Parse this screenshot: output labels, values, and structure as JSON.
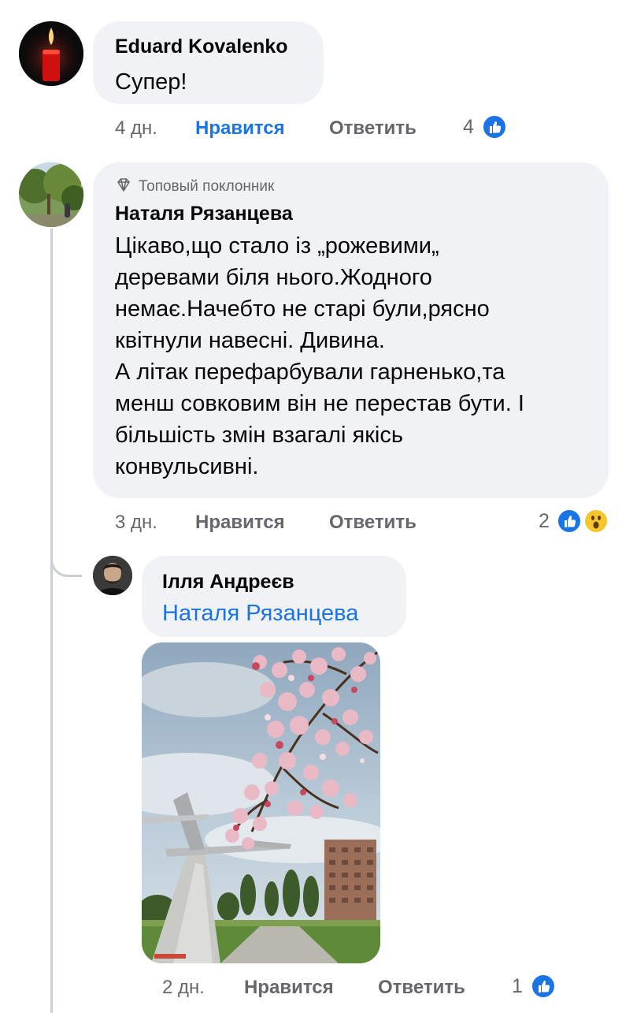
{
  "comments": [
    {
      "author": "Eduard Kovalenko",
      "text": "Супер!",
      "time": "4 дн.",
      "like_label": "Нравится",
      "reply_label": "Ответить",
      "reaction_count": "4",
      "reactions": [
        "like-icon"
      ],
      "liked": true
    },
    {
      "badge": "Топовый поклонник",
      "badge_icon": "diamond-icon",
      "author": "Наталя Рязанцева",
      "text_lines": [
        "Цікаво,що стало із „рожевими„",
        "деревами біля нього.Жодного",
        "немає.Начебто не старі були,рясно",
        "квітнули навесні. Дивина.",
        "А літак перефарбували гарненько,та",
        "менш совковим він не перестав бути. І",
        "більшість змін взагалі якісь",
        "конвульсивні."
      ],
      "time": "3 дн.",
      "like_label": "Нравится",
      "reply_label": "Ответить",
      "reaction_count": "2",
      "reactions": [
        "like-icon",
        "wow-icon"
      ],
      "liked": false
    }
  ],
  "reply": {
    "author": "Ілля Андреєв",
    "mention": "Наталя Рязанцева",
    "time": "2 дн.",
    "like_label": "Нравится",
    "reply_label": "Ответить",
    "reaction_count": "1",
    "reactions": [
      "like-icon"
    ],
    "liked": false
  },
  "colors": {
    "bubble": "#f0f2f5",
    "accent_blue": "#1b74e4",
    "meta_gray": "#65676b",
    "thread_line": "#ccd0d5"
  }
}
